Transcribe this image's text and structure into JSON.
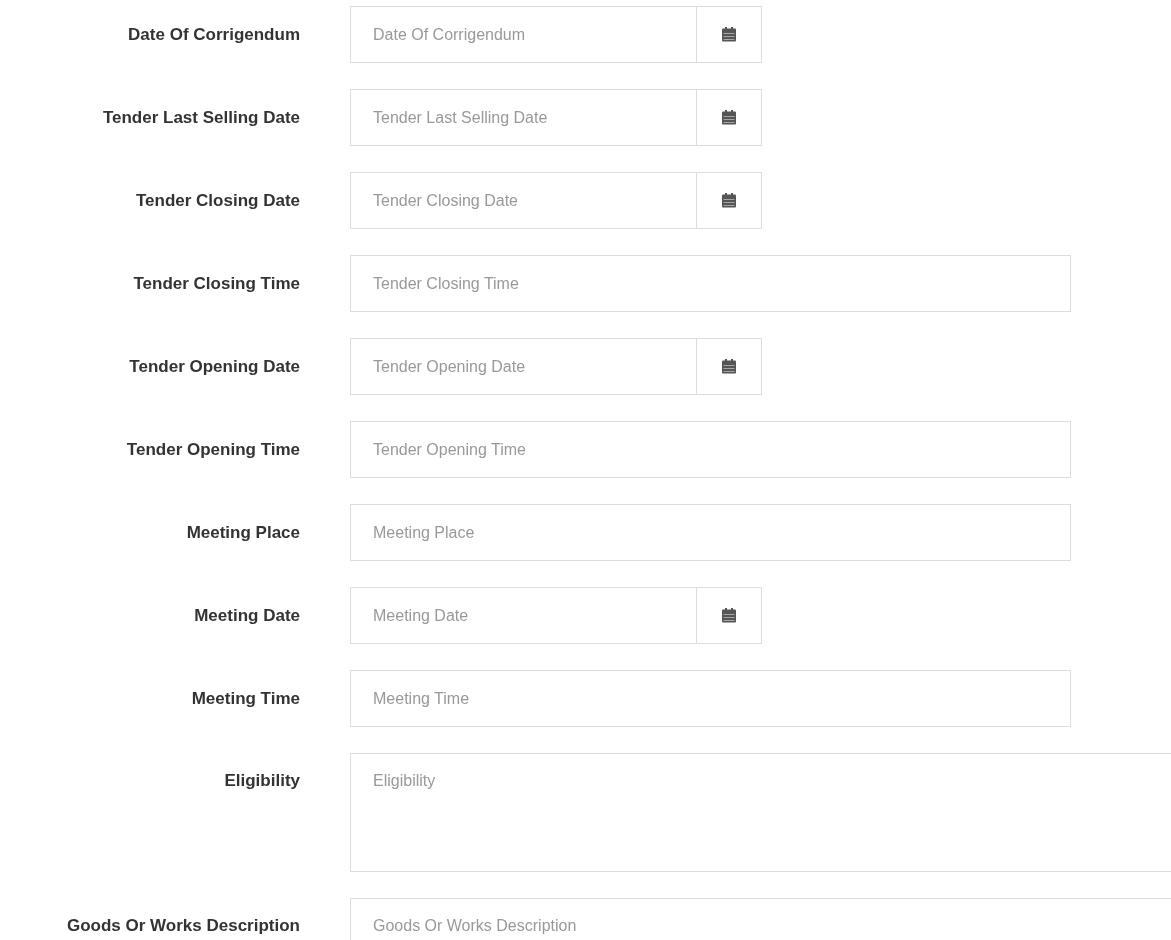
{
  "fields": [
    {
      "label": "Date Of Corrigendum",
      "placeholder": "Date Of Corrigendum",
      "kind": "date"
    },
    {
      "label": "Tender Last Selling Date",
      "placeholder": "Tender Last Selling Date",
      "kind": "date"
    },
    {
      "label": "Tender Closing Date",
      "placeholder": "Tender Closing Date",
      "kind": "date"
    },
    {
      "label": "Tender Closing Time",
      "placeholder": "Tender Closing Time",
      "kind": "text"
    },
    {
      "label": "Tender Opening Date",
      "placeholder": "Tender Opening Date",
      "kind": "date"
    },
    {
      "label": "Tender Opening Time",
      "placeholder": "Tender Opening Time",
      "kind": "text"
    },
    {
      "label": "Meeting Place",
      "placeholder": "Meeting Place",
      "kind": "text"
    },
    {
      "label": "Meeting Date",
      "placeholder": "Meeting Date",
      "kind": "date"
    },
    {
      "label": "Meeting Time",
      "placeholder": "Meeting Time",
      "kind": "text"
    },
    {
      "label": "Eligibility",
      "placeholder": "Eligibility",
      "kind": "textarea"
    },
    {
      "label": "Goods Or Works Description",
      "placeholder": "Goods Or Works Description",
      "kind": "textarea"
    }
  ]
}
